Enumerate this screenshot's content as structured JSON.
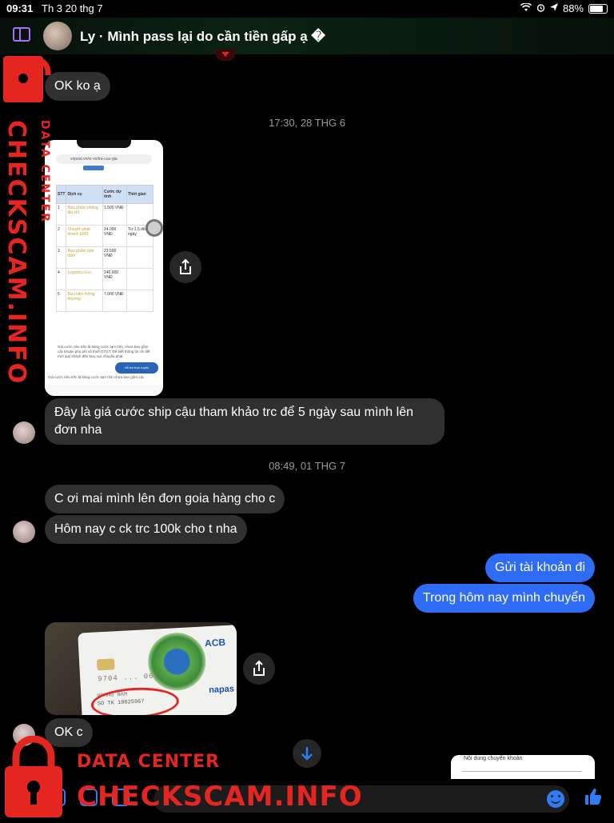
{
  "status_bar": {
    "time": "09:31",
    "date": "Th 3 20 thg 7",
    "battery": "88%"
  },
  "header": {
    "title": "Ly · Mình pass lại do cần tiền gấp ạ �"
  },
  "messages": {
    "m1": "OK ko ạ",
    "ts1": "17:30, 28 THG 6",
    "m2": "Đây là giá cước ship cậu tham khảo trc để 5 ngày sau mình lên đơn nha",
    "ts2": "08:49, 01 THG 7",
    "m3": "C ơi mai mình lên đơn goia hàng cho c",
    "m4": "Hôm nay c ck trc 100k cho t nha",
    "m5": "Gửi tài khoản đi",
    "m6": "Trong hôm nay mình chuyển",
    "m7": "OK c"
  },
  "phone_screenshot": {
    "url": "vnpost.vn/vi-vn/tra-cuu-gia",
    "headers": [
      "STT",
      "Dịch vụ",
      "Cước dự tính",
      "Thời gian"
    ],
    "rows": [
      [
        "1",
        "Bưu phẩm không địa chỉ",
        "1.500 VNĐ",
        ""
      ],
      [
        "2",
        "Chuyển phát nhanh EMS",
        "14.000 VNĐ",
        "Từ 1.5 đến 2 ngày"
      ],
      [
        "3",
        "Bưu phẩm bảo đảm",
        "23.500 VNĐ",
        ""
      ],
      [
        "4",
        "Logistics Eco",
        "140.000 VNĐ",
        ""
      ],
      [
        "5",
        "Bưu kiện thông thường",
        "7.000 VNĐ",
        ""
      ]
    ],
    "note": "Giá cước nêu trên là bảng cước tạm tính, chưa bao gồm các khoản phụ phí và thuế GTGT. Để biết thông tin chi tiết mời quý khách đến bưu cục chuyển phát",
    "fab": "Hỗ trợ trực tuyến",
    "footer": "Giá cước nêu trên là bảng cước tạm tính chưa bao gồm các"
  },
  "card": {
    "bank": "ACB",
    "number": "9704 ... 067",
    "name": "HOANG NAM",
    "account": "SO TK 10025967",
    "network": "napas"
  },
  "preview": {
    "label": "Nội dung chuyển khoản"
  },
  "watermark": {
    "vertical_big": "CHECKSCAM.INFO",
    "vertical_small": "DATA CENTER",
    "bottom_small": "DATA CENTER",
    "bottom_big": "CHECKSCAM.INFO"
  },
  "colors": {
    "accent": "#2f6cf6",
    "bubble_other": "#303030",
    "watermark": "#e52620"
  }
}
